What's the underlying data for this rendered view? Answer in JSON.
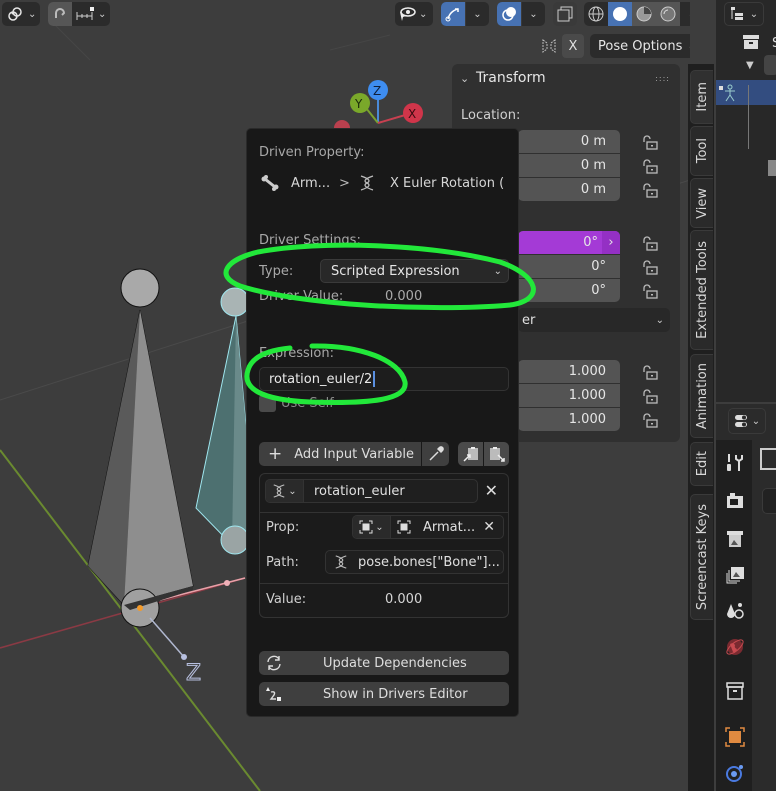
{
  "header": {
    "left_group_1": {
      "icon": "pivot-link-icon"
    },
    "left_group_2": {
      "snap_icon": "magnet-icon",
      "snap_target_icon": "snap-increment-icon"
    },
    "right_groups": {
      "visibility_icon": "eye-select-icon",
      "gizmo_icon": "gizmo-icon",
      "overlay_icon": "overlay-icon",
      "xray_icon": "xray-icon",
      "shading_modes": [
        "wireframe",
        "solid",
        "material-preview",
        "rendered"
      ],
      "shading_active": "solid"
    },
    "mirror_x_label": "X",
    "pose_options_label": "Pose Options"
  },
  "axis_gizmo": {
    "x": "X",
    "y": "Y",
    "z": "Z"
  },
  "transform_panel": {
    "title": "Transform",
    "location_label": "Location:",
    "location": [
      "0 m",
      "0 m",
      "0 m"
    ],
    "rotation": [
      "0°",
      "0°",
      "0°"
    ],
    "rotation_mode_partial": "er",
    "scale": [
      "1.000",
      "1.000",
      "1.000"
    ],
    "colors": {
      "driven": "#a43ad6"
    }
  },
  "side_tabs": [
    "Item",
    "Tool",
    "View",
    "Extended Tools",
    "Animation",
    "Edit",
    "Screencast Keys"
  ],
  "outliner": {
    "partial_label_1": "S",
    "partial_label_2": "S"
  },
  "driver_popup": {
    "driven_property_label": "Driven Property:",
    "driven_object": "Arm...",
    "breadcrumb_sep": ">",
    "driven_property": "X Euler Rotation (",
    "driver_settings_label": "Driver Settings:",
    "type_label": "Type:",
    "type_value": "Scripted Expression",
    "driver_value_label": "Driver Value:",
    "driver_value": "0.000",
    "expression_label": "Expression:",
    "expression_value": "rotation_euler/2",
    "use_self_label": "Use Self",
    "add_variable_label": "Add Input Variable",
    "variable": {
      "name": "rotation_euler",
      "prop_label": "Prop:",
      "prop_target": "Armat...",
      "path_label": "Path:",
      "path_value": "pose.bones[\"Bone\"]...",
      "value_label": "Value:",
      "value": "0.000"
    },
    "update_dependencies_label": "Update Dependencies",
    "show_in_drivers_editor_label": "Show in Drivers Editor"
  },
  "annotation_color": "#22e83a"
}
